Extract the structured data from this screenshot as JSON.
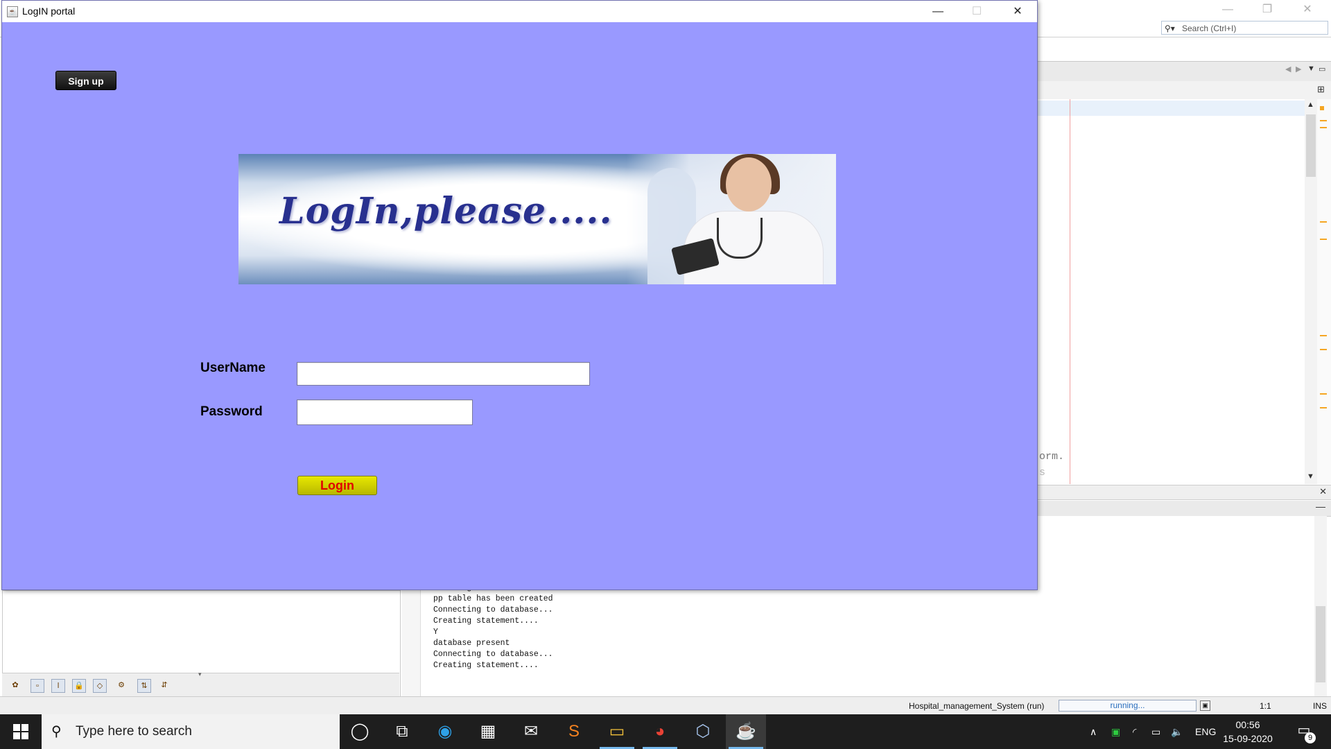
{
  "ide": {
    "search_placeholder": "Search (Ctrl+I)",
    "code_fragments": [
      "orm.",
      "s"
    ],
    "output_lines": [
      "Creating statement....",
      "pp table has been created",
      "Connecting to database...",
      "Creating statement....",
      "Y",
      "database present",
      "Connecting to database...",
      "Creating statement...."
    ],
    "status": {
      "project": "Hospital_management_System (run)",
      "progress_label": "running...",
      "position": "1:1",
      "mode": "INS"
    }
  },
  "login_window": {
    "title": "LogIN portal",
    "signup_label": "Sign up",
    "banner_text": "LogIn,please.....",
    "username_label": "UserName",
    "password_label": "Password",
    "username_value": "",
    "password_value": "",
    "login_label": "Login",
    "window_controls": {
      "minimize": "—",
      "maximize": "☐",
      "close": "✕"
    }
  },
  "taskbar": {
    "search_placeholder": "Type here to search",
    "apps": [
      "cortana-icon",
      "task-view-icon",
      "edge-icon",
      "store-icon",
      "mail-icon",
      "sublime-icon",
      "file-explorer-icon",
      "chrome-icon",
      "app-cube-icon",
      "java-icon"
    ],
    "tray": {
      "language": "ENG",
      "time": "00:56",
      "date": "15-09-2020",
      "notification_count": "9"
    }
  },
  "colors": {
    "login_bg": "#9999ff",
    "signup_bg": "#111111",
    "login_btn_bg": "#d4d400",
    "login_btn_text": "#e00000",
    "banner_text": "#28308f"
  }
}
